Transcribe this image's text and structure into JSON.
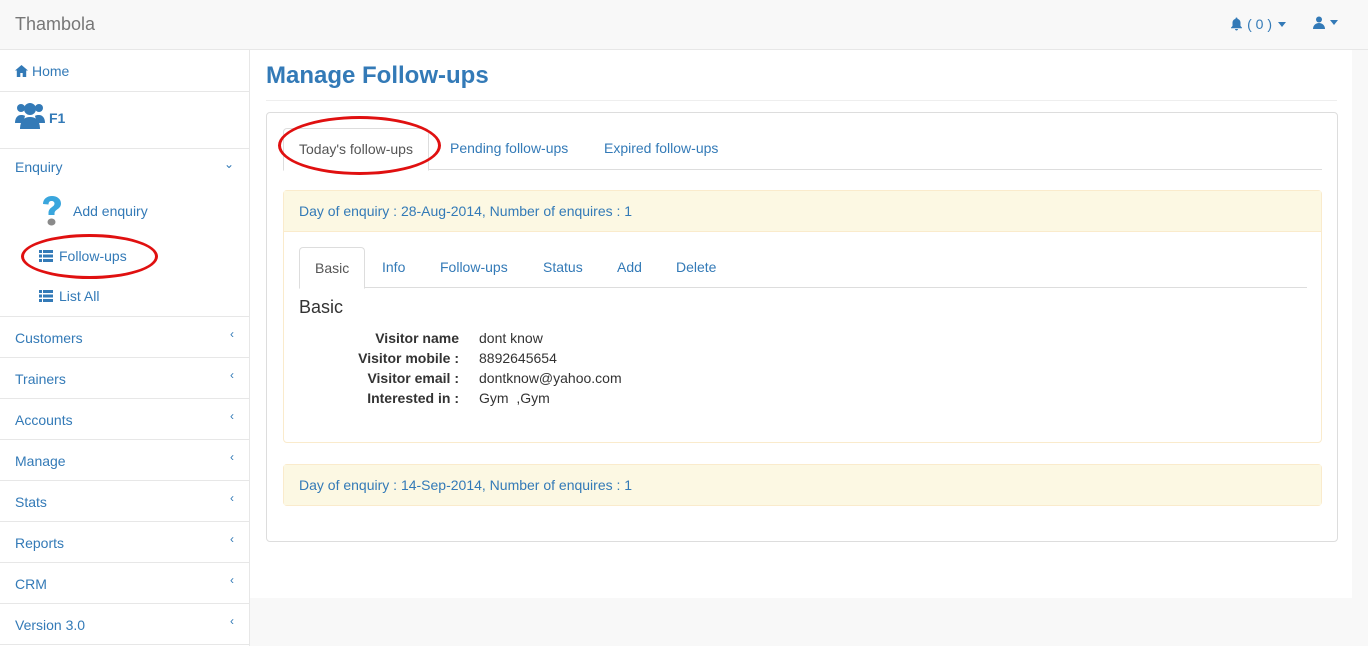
{
  "navbar": {
    "brand": "Thambola",
    "notifications": "( 0 )",
    "icons": {
      "bell": "bell-icon",
      "user": "user-icon"
    }
  },
  "sidebar": {
    "home": "Home",
    "group": "F1",
    "enquiry": "Enquiry",
    "sub": {
      "add": "Add enquiry",
      "followups": "Follow-ups",
      "list": "List All"
    },
    "items": [
      "Customers",
      "Trainers",
      "Accounts",
      "Manage",
      "Stats",
      "Reports",
      "CRM",
      "Version 3.0"
    ]
  },
  "main": {
    "title": "Manage Follow-ups",
    "tabs": [
      "Today's follow-ups",
      "Pending follow-ups",
      "Expired follow-ups"
    ],
    "groups": [
      {
        "heading": "Day of enquiry : 28-Aug-2014, Number of enquires : 1",
        "inner_tabs": [
          "Basic",
          "Info",
          "Follow-ups",
          "Status",
          "Add",
          "Delete"
        ],
        "section_title": "Basic",
        "details": [
          {
            "key": "Visitor name",
            "value": "dont know"
          },
          {
            "key": "Visitor mobile :",
            "value": "8892645654"
          },
          {
            "key": "Visitor email :",
            "value": "dontknow@yahoo.com"
          },
          {
            "key": "Interested in :",
            "value": "Gym  ,Gym"
          }
        ]
      },
      {
        "heading": "Day of enquiry : 14-Sep-2014, Number of enquires : 1"
      }
    ]
  },
  "colors": {
    "link": "#337ab7",
    "warning_bg": "#fcf8e3",
    "annotation": "#e01010"
  }
}
